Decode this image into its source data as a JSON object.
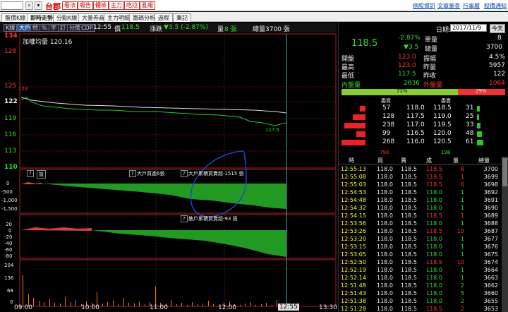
{
  "topbar": {
    "search_value": "",
    "stock_name": "台郡",
    "buttons": [
      "看法",
      "報告",
      "體檢",
      "主力",
      "吃拉",
      "亂報"
    ],
    "links": [
      "個股資訊",
      "文章量查",
      "行事曆",
      "股價通知"
    ]
  },
  "tabs": [
    "盤價K線",
    "即時走勢",
    "分點K線",
    "大量券商",
    "主力明細",
    "籌碼分析",
    "過程",
    "筆記"
  ],
  "toolbar": {
    "chips": [
      "K線",
      "大戶",
      "特",
      "%",
      "字",
      "訂",
      "分價",
      "CDP"
    ],
    "time": "12:55",
    "price_label": "價",
    "price": "118.5",
    "change_label": "漲跌",
    "change": "▼3.5 (-2.87%)",
    "vol_label": "量",
    "vol": "8 張",
    "total_label": "總量",
    "total": "3700 張"
  },
  "chart": {
    "title": "加權均量 120.16",
    "yticks": [
      "134",
      "128",
      "125",
      "122",
      "119",
      "116",
      "113",
      "110"
    ],
    "left_mark": "123",
    "low_mark": "117.5",
    "sub1_ticks": [
      "0",
      "-500",
      "-1,000",
      "-1,500"
    ],
    "sub1_label_a": "大戶買進6張",
    "sub1_label_b": "大戶累積買賣超-1515 張",
    "sub2_ticks": [
      "20",
      "0",
      "-20",
      "-40",
      "-60",
      "-80"
    ],
    "sub2_label": "散戶累積買賣超-93 張",
    "vol_ticks": [
      "204",
      "136",
      "68",
      "0"
    ],
    "xticks": [
      "09:00",
      "10:00",
      "11:00",
      "12:00",
      "13:30"
    ],
    "cursor_time": "12:55",
    "q1": "?",
    "q2": "設",
    "q3": "?",
    "q4": "?",
    "q5": "?"
  },
  "quote": {
    "date_label": "日期:",
    "date": "2017/11/9",
    "today_btn": "今天",
    "price": "118.5",
    "pct": "-2.87%",
    "chg": "▼3.5",
    "labels": {
      "single": "單量",
      "total": "總量",
      "open": "開盤",
      "high": "最高",
      "low": "最低",
      "amp": "振幅",
      "vol_prev": "昨量",
      "prev": "昨收",
      "inner": "內盤量",
      "outer": "外盤量"
    },
    "single": "8",
    "total": "3700",
    "open": "123.0",
    "high": "123.0",
    "low": "117.5",
    "amp": "4.5%",
    "vol_prev": "5957",
    "prev": "122",
    "inner": "2636",
    "outer": "1064",
    "inner_pct": "71%",
    "outer_pct": "29%",
    "buy_head": "委買",
    "sell_head": "委賣",
    "sum_buy": "790",
    "sum_sell": "198"
  },
  "book": [
    {
      "bq": "57",
      "bp": "118.0",
      "sp": "118.5",
      "sq": "31",
      "bw": 8,
      "sw": 4
    },
    {
      "bq": "128",
      "bp": "117.5",
      "sp": "119.0",
      "sq": "25",
      "bw": 18,
      "sw": 3
    },
    {
      "bq": "238",
      "bp": "117.0",
      "sp": "119.5",
      "sq": "33",
      "bw": 30,
      "sw": 5
    },
    {
      "bq": "99",
      "bp": "116.5",
      "sp": "120.0",
      "sq": "48",
      "bw": 13,
      "sw": 7
    },
    {
      "bq": "268",
      "bp": "116.0",
      "sp": "120.5",
      "sq": "61",
      "bw": 34,
      "sw": 9
    }
  ],
  "ticks_head": [
    "時",
    "買",
    "賣",
    "成",
    "量",
    "總量"
  ],
  "ticks": [
    [
      "12:55:13",
      "118.0",
      "118.5",
      "118.5",
      "8",
      "3700"
    ],
    [
      "12:55:08",
      "118.0",
      "118.5",
      "118.5",
      "1",
      "3699"
    ],
    [
      "12:55:03",
      "118.0",
      "118.5",
      "118.5",
      "6",
      "3698"
    ],
    [
      "12:54:53",
      "118.0",
      "118.5",
      "118.0",
      "1",
      "3692"
    ],
    [
      "12:54:48",
      "118.0",
      "118.5",
      "118.0",
      "1",
      "3691"
    ],
    [
      "12:54:32",
      "118.0",
      "118.5",
      "118.0",
      "1",
      "3690"
    ],
    [
      "12:54:15",
      "118.0",
      "118.5",
      "118.5",
      "1",
      "3689"
    ],
    [
      "12:53:56",
      "118.0",
      "118.5",
      "118.0",
      "1",
      "3688"
    ],
    [
      "12:53:26",
      "118.0",
      "118.5",
      "118.5",
      "10",
      "3687"
    ],
    [
      "12:53:20",
      "118.0",
      "118.5",
      "118.0",
      "1",
      "3677"
    ],
    [
      "12:53:15",
      "118.0",
      "118.5",
      "118.0",
      "1",
      "3676"
    ],
    [
      "12:53:05",
      "118.0",
      "118.5",
      "118.0",
      "1",
      "3675"
    ],
    [
      "12:52:50",
      "118.0",
      "118.5",
      "118.5",
      "10",
      "3674"
    ],
    [
      "12:52:19",
      "118.0",
      "118.5",
      "118.0",
      "1",
      "3664"
    ],
    [
      "12:52:14",
      "118.0",
      "118.5",
      "118.0",
      "1",
      "3663"
    ],
    [
      "12:51:48",
      "118.0",
      "118.5",
      "118.0",
      "2",
      "3662"
    ],
    [
      "12:51:43",
      "118.0",
      "118.5",
      "118.0",
      "5",
      "3660"
    ],
    [
      "12:51:38",
      "118.0",
      "118.5",
      "118.0",
      "2",
      "3655"
    ],
    [
      "12:51:28",
      "118.0",
      "118.5",
      "118.5",
      "2",
      "3653"
    ]
  ]
}
